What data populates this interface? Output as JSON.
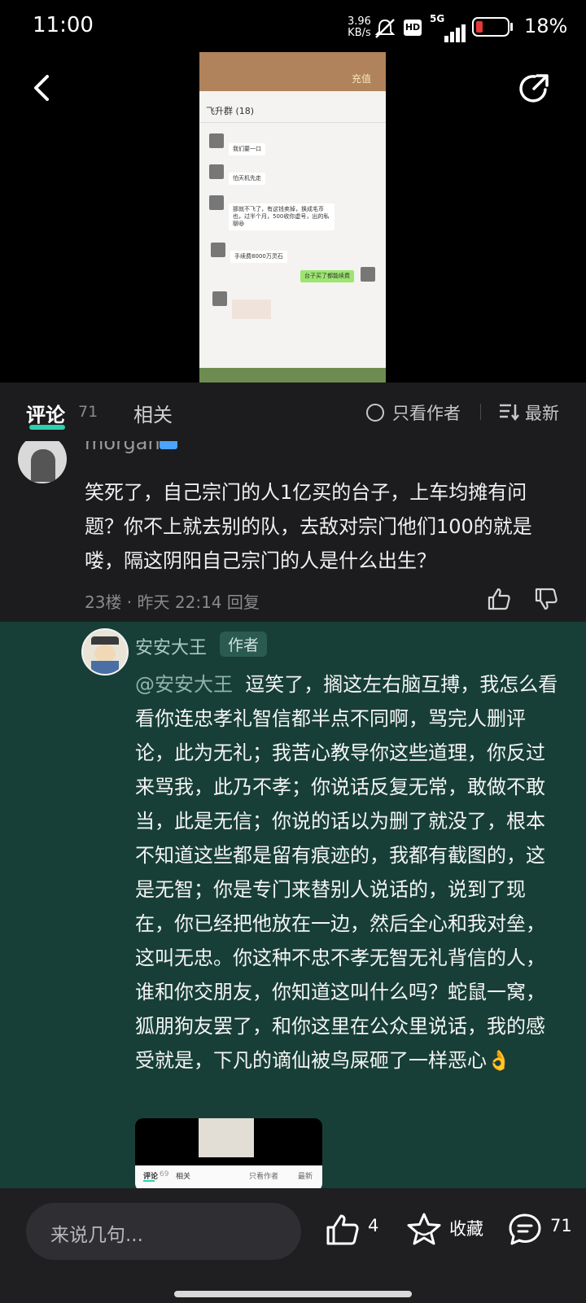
{
  "status_bar": {
    "time": "11:00",
    "net_speed_value": "3.96",
    "net_speed_unit": "KB/s",
    "hd_label": "HD",
    "signal_label": "5G",
    "battery_percent": "18%",
    "battery_color": "#e53935"
  },
  "video": {
    "top_banner_text": "充值",
    "chat_group_name": "飞升群 (18)",
    "messages": [
      {
        "text": "我们要一口"
      },
      {
        "text": "怕天机先走"
      },
      {
        "text": "那就不飞了，有这钱卖掉，换成毛币也，过半个月，500收你虚号，出的私聊😆"
      },
      {
        "text": "手续费8000万灵石"
      },
      {
        "text": "台子买了都能续费"
      }
    ]
  },
  "tabs": {
    "comments_label": "评论",
    "comments_count": "71",
    "related_label": "相关",
    "only_author_label": "只看作者",
    "sort_label": "最新",
    "accent_color": "#2fcfb0"
  },
  "top_comment": {
    "username": "morgan",
    "text": "笑死了，自己宗门的人1亿买的台子，上车均摊有问题？你不上就去别的队，去敌对宗门他们100的就是喽，隔这阴阳自己宗门的人是什么出生？",
    "meta": "23楼 · 昨天 22:14  回复"
  },
  "reply": {
    "username": "安安大王",
    "author_tag": "作者",
    "mention": "@安安大王",
    "text": "逗笑了，搁这左右脑互搏，我怎么看看你连忠孝礼智信都半点不同啊，骂完人删评论，此为无礼；我苦心教导你这些道理，你反过来骂我，此乃不孝；你说话反复无常，敢做不敢当，此是无信；你说的话以为删了就没了，根本不知道这些都是留有痕迹的，我都有截图的，这是无智；你是专门来替别人说话的，说到了现在，你已经把他放在一边，然后全心和我对垒，这叫无忠。你这种不忠不孝无智无礼背信的人，谁和你交朋友，你知道这叫什么吗？蛇鼠一窝，狐朋狗友罢了，和你这里在公众里说话，我的感受就是，下凡的谪仙被鸟屎砸了一样恶心👌",
    "thumb_tab_comments": "评论",
    "thumb_comments_count": "69",
    "thumb_tab_related": "相关",
    "thumb_only_author": "只看作者",
    "thumb_sort": "最新",
    "bg_color": "#173f37"
  },
  "bottom_bar": {
    "input_placeholder": "来说几句...",
    "like_count": "4",
    "favorite_label": "收藏",
    "comment_count": "71"
  }
}
